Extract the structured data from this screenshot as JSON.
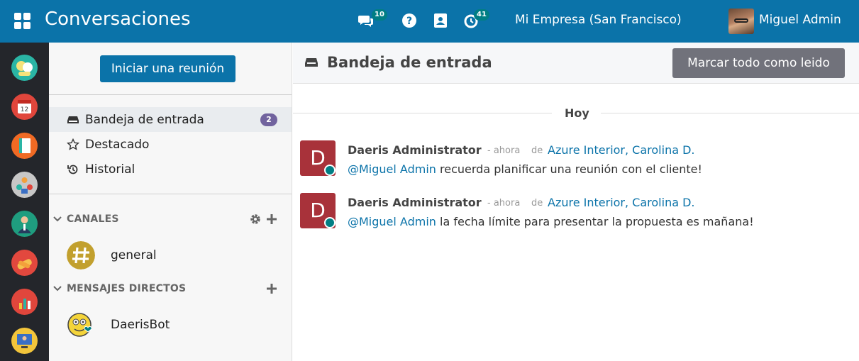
{
  "topbar": {
    "app_title": "Conversaciones",
    "chat_count": "10",
    "activity_count": "41",
    "company": "Mi Empresa (San Francisco)",
    "user_name": "Miguel Admin",
    "bg_color": "#0b73a9"
  },
  "rail": {
    "apps": [
      {
        "icon": "chat-app-icon",
        "color": "#2ab5a5"
      },
      {
        "icon": "calendar-app-icon",
        "color": "#e0463c"
      },
      {
        "icon": "notebook-app-icon",
        "color": "#f06a24"
      },
      {
        "icon": "team-app-icon",
        "color": "#c7c7c7"
      },
      {
        "icon": "employee-app-icon",
        "color": "#1f9d7f"
      },
      {
        "icon": "handshake-app-icon",
        "color": "#e2483e"
      },
      {
        "icon": "chart-app-icon",
        "color": "#e0463c"
      },
      {
        "icon": "presentation-app-icon",
        "color": "#f3c53b"
      }
    ]
  },
  "sidebar": {
    "meeting_button": "Iniciar una reunión",
    "nav": [
      {
        "label": "Bandeja de entrada",
        "badge": "2",
        "icon": "inbox-icon",
        "active": true
      },
      {
        "label": "Destacado",
        "icon": "star-icon"
      },
      {
        "label": "Historial",
        "icon": "history-icon"
      }
    ],
    "channels_title": "CANALES",
    "channels": [
      {
        "name": "general",
        "icon": "hashtag-icon"
      }
    ],
    "direct_title": "MENSAJES DIRECTOS",
    "direct": [
      {
        "name": "DaerisBot",
        "icon": "bot-avatar-icon"
      }
    ]
  },
  "main": {
    "title": "Bandeja de entrada",
    "mark_all_button": "Marcar todo como leido",
    "day_label": "Hoy",
    "messages": [
      {
        "avatar_letter": "D",
        "author": "Daeris Administrator",
        "time": "- ahora",
        "origin_prefix": "de",
        "origin": "Azure Interior, Carolina D.",
        "mention": "@Miguel Admin",
        "text": " recuerda planificar una reunión con el cliente!"
      },
      {
        "avatar_letter": "D",
        "author": "Daeris Administrator",
        "time": "- ahora",
        "origin_prefix": "de",
        "origin": "Azure Interior, Carolina D.",
        "mention": "@Miguel Admin",
        "text": " la fecha límite para presentar la propuesta es mañana!"
      }
    ]
  }
}
